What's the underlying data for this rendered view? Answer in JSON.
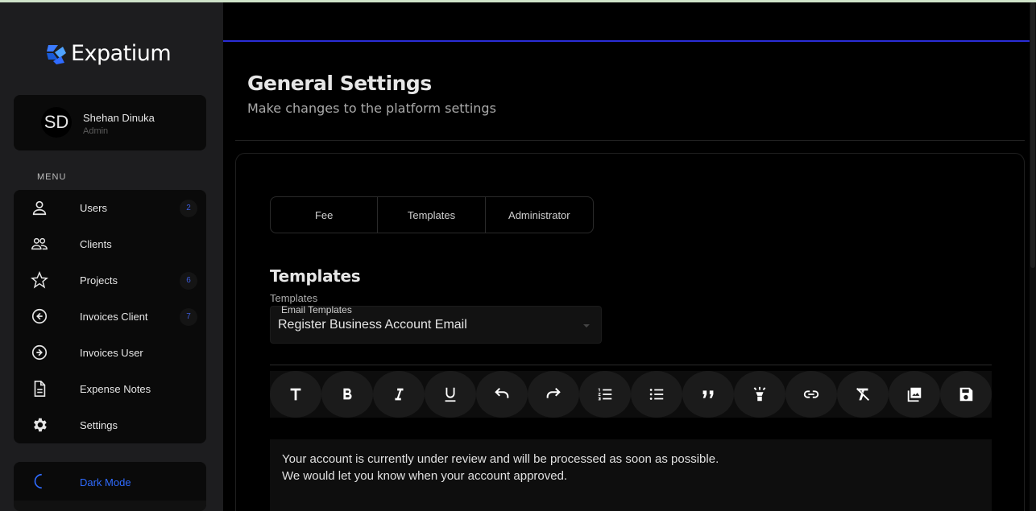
{
  "app": {
    "name": "Expatium"
  },
  "user": {
    "initials": "SD",
    "name": "Shehan Dinuka",
    "role": "Admin"
  },
  "menu": {
    "heading": "MENU",
    "items": [
      {
        "label": "Users",
        "icon": "user-icon",
        "badge": "2"
      },
      {
        "label": "Clients",
        "icon": "users-group-icon",
        "badge": null
      },
      {
        "label": "Projects",
        "icon": "star-icon",
        "badge": "6"
      },
      {
        "label": "Invoices Client",
        "icon": "arrow-left-circle-icon",
        "badge": "7"
      },
      {
        "label": "Invoices User",
        "icon": "arrow-right-circle-icon",
        "badge": null
      },
      {
        "label": "Expense Notes",
        "icon": "document-icon",
        "badge": null
      },
      {
        "label": "Settings",
        "icon": "gear-icon",
        "badge": null
      }
    ]
  },
  "dark_mode": {
    "label": "Dark Mode",
    "icon": "moon-icon"
  },
  "page": {
    "title": "General Settings",
    "subtitle": "Make changes to the platform settings"
  },
  "tabs": [
    {
      "label": "Fee"
    },
    {
      "label": "Templates"
    },
    {
      "label": "Administrator"
    }
  ],
  "templates_section": {
    "title": "Templates",
    "field_label": "Templates",
    "select_label": "Email Templates",
    "select_value": "Register Business Account Email"
  },
  "toolbar": [
    {
      "name": "text-style-icon"
    },
    {
      "name": "bold-icon"
    },
    {
      "name": "italic-icon"
    },
    {
      "name": "underline-icon"
    },
    {
      "name": "undo-icon"
    },
    {
      "name": "redo-icon"
    },
    {
      "name": "ordered-list-icon"
    },
    {
      "name": "bullet-list-icon"
    },
    {
      "name": "quote-icon"
    },
    {
      "name": "highlight-icon"
    },
    {
      "name": "link-icon"
    },
    {
      "name": "clear-format-icon"
    },
    {
      "name": "image-icon"
    },
    {
      "name": "save-icon"
    }
  ],
  "editor": {
    "line1": "Your account is currently under review and will be processed as soon as possible.",
    "line2": "We would let you know when your account approved."
  },
  "colors": {
    "accent": "#2f6bff",
    "topbar_line": "#2a2dd6",
    "badge_text": "#3b5bdb",
    "sidebar_bg": "#1d1d1f"
  }
}
